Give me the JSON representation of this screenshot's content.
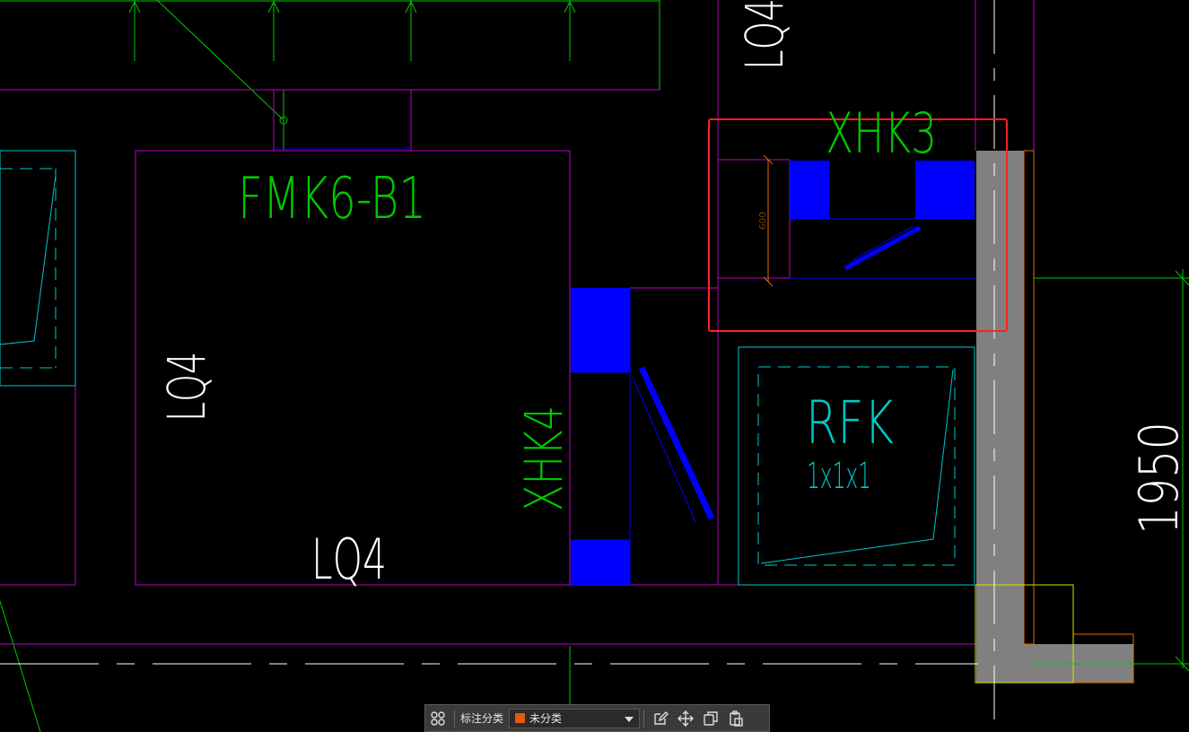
{
  "drawing": {
    "labels": {
      "room_main": "FMK6-B1",
      "wall_left": "LQ4",
      "wall_bottom": "LQ4",
      "wall_top_right": "LQ4",
      "hatch_vertical": "XHK4",
      "hatch_top": "XHK3",
      "rfk_title": "RFK",
      "rfk_size": "1x1x1",
      "dim_small": "600",
      "dim_large": "1950"
    },
    "colors": {
      "magenta": "#c000c0",
      "green": "#00c800",
      "cyan": "#00c8c8",
      "blue": "#0000ff",
      "gray": "#808080",
      "yellow": "#e0e000",
      "orange": "#e07000",
      "highlight_red": "#ff2020",
      "white": "#ffffff"
    }
  },
  "toolbar": {
    "grid_icon": "grid-icon",
    "category_label": "标注分类",
    "category_value": "未分类",
    "category_color": "#e05a10",
    "edit_icon": "edit-icon",
    "move_icon": "move-icon",
    "copy_icon": "copy-icon",
    "paste_icon": "paste-icon"
  }
}
